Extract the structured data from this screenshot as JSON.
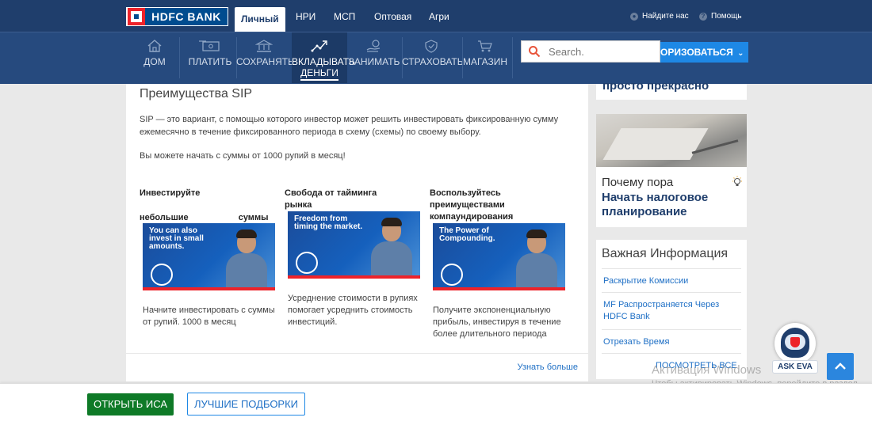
{
  "header": {
    "logo_text": "HDFC BANK",
    "segments": [
      "Личный",
      "НРИ",
      "МСП",
      "Оптовая",
      "Агри"
    ],
    "find_us": "Найдите нас",
    "help": "Помощь"
  },
  "nav": {
    "items": [
      {
        "label": "ДОМ",
        "label2": "",
        "icon": "home-icon"
      },
      {
        "label": "ПЛАТИТЬ",
        "label2": "",
        "icon": "pay-card-icon"
      },
      {
        "label": "СОХРАНЯТЬ",
        "label2": "",
        "icon": "bank-building-icon"
      },
      {
        "label": "ВКЛАДЫВАТЬ",
        "label2": "ДЕНЬГИ",
        "icon": "invest-chart-icon"
      },
      {
        "label": "ЗАНИМАТЬ",
        "label2": "",
        "icon": "borrow-coins-icon"
      },
      {
        "label": "СТРАХОВАТЬ",
        "label2": "",
        "icon": "insurance-shield-icon"
      },
      {
        "label": "МАГАЗИН",
        "label2": "",
        "icon": "shopping-cart-icon"
      }
    ],
    "search_placeholder": "Search.",
    "login_label": "ОРИЗОВАТЬСЯ"
  },
  "main": {
    "title": "Преимущества SIP",
    "description": "SIP — это вариант, с помощью которого инвестор может решить инвестировать фиксированную сумму ежемесячно в течение фиксированного периода в схему (схемы) по своему выбору.",
    "min_amount": "Вы можете начать с суммы от 1000 рупий в месяц!",
    "cards": [
      {
        "title": "Инвестируйте небольшие суммы",
        "image_text": "You can also invest in small amounts.",
        "description": "Начните инвестировать с суммы от рупий. 1000 в месяц"
      },
      {
        "title": "Свобода от тайминга рынка",
        "image_text": "Freedom from timing the market.",
        "description": "Усреднение стоимости в рупиях помогает усреднить стоимость инвестиций."
      },
      {
        "title": "Воспользуйтесь преимуществами компаундирования",
        "image_text": "The Power of Compounding.",
        "description": "Получите экспоненциальную прибыль, инвестируя в течение более длительного периода"
      }
    ],
    "learn_more": "Узнать больше"
  },
  "sidebar": {
    "promo_top": "просто прекрасно",
    "tax_line1": "Почему пора",
    "tax_line2": "Начать налоговое планирование",
    "info_title": "Важная Информация",
    "links": [
      "Раскрытие Комиссии",
      "MF Распространяется Через HDFC Bank",
      "Отрезать Время"
    ],
    "view_all": "ПОСМОТРЕТЬ ВСЕ"
  },
  "watermark": {
    "line1": "Активация Windows",
    "line2": "Чтобы активировать Windows, перейдите в раздел \"Параметры\"."
  },
  "eva": {
    "label": "ASK EVA"
  },
  "bottom": {
    "open_label": "ОТКРЫТЬ ИСА",
    "best_label": "ЛУЧШИЕ ПОДБОРКИ"
  },
  "colors": {
    "header_bg": "#1f3e6c",
    "nav_bg": "#264a7e",
    "accent_blue": "#1e88e5",
    "brand_red": "#ed232a",
    "cta_green": "#0e7a27"
  }
}
